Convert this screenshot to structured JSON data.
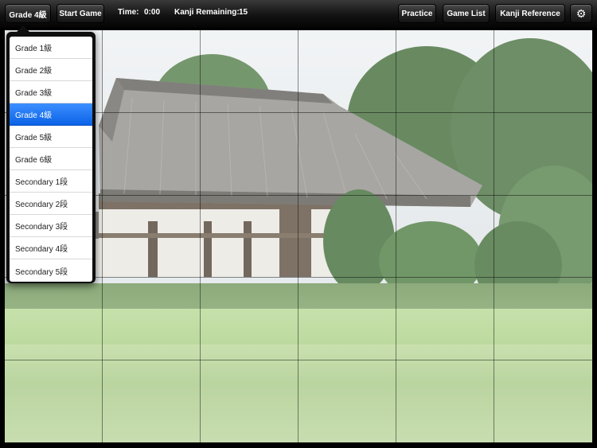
{
  "toolbar": {
    "grade_button_label": "Grade 4級",
    "start_button_label": "Start Game",
    "time_label": "Time:",
    "time_value": "0:00",
    "kanji_remaining_label": "Kanji Remaining:",
    "kanji_remaining_value": "15",
    "practice_label": "Practice",
    "game_list_label": "Game List",
    "kanji_reference_label": "Kanji Reference",
    "settings_icon": "gear-icon"
  },
  "grade_menu": {
    "selected": "Grade 4級",
    "items": [
      {
        "label": "Grade 1級"
      },
      {
        "label": "Grade 2級"
      },
      {
        "label": "Grade 3級"
      },
      {
        "label": "Grade 4級"
      },
      {
        "label": "Grade 5級"
      },
      {
        "label": "Grade 6級"
      },
      {
        "label": "Secondary 1段"
      },
      {
        "label": "Secondary 2段"
      },
      {
        "label": "Secondary 3段"
      },
      {
        "label": "Secondary 4段"
      },
      {
        "label": "Secondary 5段"
      }
    ]
  },
  "board": {
    "columns": 6,
    "rows": 5
  },
  "colors": {
    "selection": "#1a73f0",
    "toolbar": "#1a1a1a"
  }
}
